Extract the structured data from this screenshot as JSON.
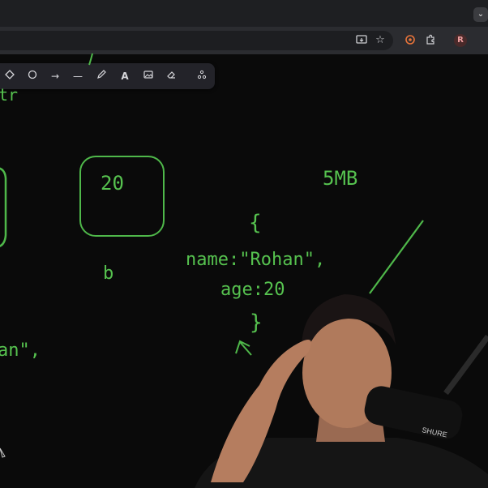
{
  "browser": {
    "toolbar_icons": [
      "install-app-icon",
      "bookmark-star-icon",
      "extension-puzzle-icon",
      "extensions-icon"
    ],
    "profile_initial": "R",
    "tab_menu_icon": "chevron-down-icon"
  },
  "excalidraw_toolbar": {
    "tools": [
      "diamond",
      "ellipse",
      "arrow",
      "line",
      "draw",
      "text",
      "image",
      "eraser",
      "more-tools"
    ]
  },
  "canvas": {
    "partial_top_text": "tr",
    "box_value": "20",
    "box_label": "b",
    "memory_label": "5MB",
    "object_open": "{",
    "object_name": "name:\"Rohan\",",
    "object_age": "age:20",
    "object_close": "}",
    "partial_left_text": "an\","
  },
  "colors": {
    "ink": "#4fb84a",
    "background": "#0a0a0a",
    "toolbar": "#232329"
  }
}
